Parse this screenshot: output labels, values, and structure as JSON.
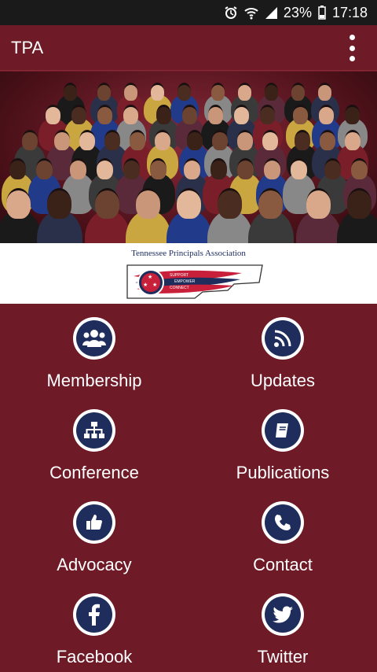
{
  "status_bar": {
    "battery": "23%",
    "time": "17:18",
    "icons": [
      "alarm-icon",
      "wifi-icon",
      "signal-icon",
      "battery-icon"
    ]
  },
  "app_bar": {
    "title": "TPA",
    "menu_icon": "more-vertical-icon"
  },
  "banner": {
    "logo_text": "Tennessee Principals Association",
    "logo_words": [
      "SUPPORT",
      "EMPOWER",
      "CONNECT"
    ]
  },
  "menu": [
    {
      "label": "Membership",
      "icon": "group-icon"
    },
    {
      "label": "Updates",
      "icon": "rss-icon"
    },
    {
      "label": "Conference",
      "icon": "sitemap-icon"
    },
    {
      "label": "Publications",
      "icon": "book-icon"
    },
    {
      "label": "Advocacy",
      "icon": "thumbs-up-icon"
    },
    {
      "label": "Contact",
      "icon": "phone-icon"
    },
    {
      "label": "Facebook",
      "icon": "facebook-icon"
    },
    {
      "label": "Twitter",
      "icon": "twitter-icon"
    }
  ],
  "colors": {
    "primary": "#6e1a27",
    "icon_bg": "#1f2d5c",
    "status_bar": "#1a1a1a"
  }
}
